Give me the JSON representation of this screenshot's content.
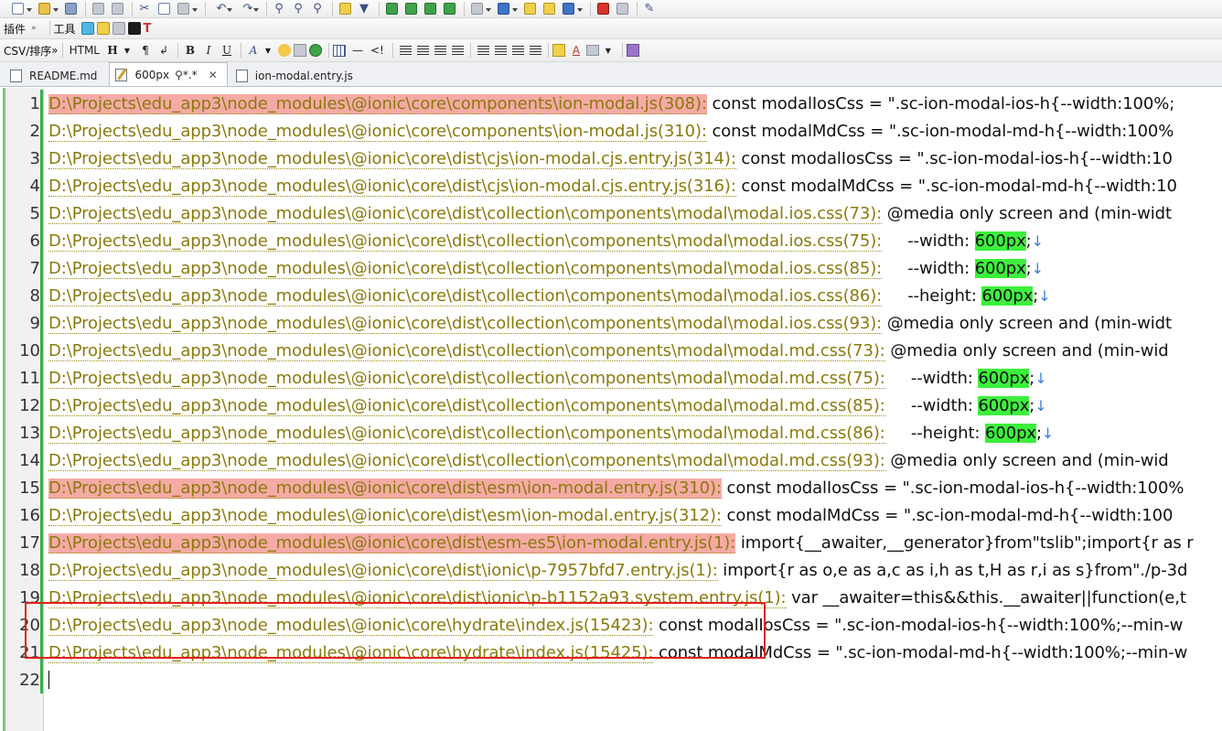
{
  "toolbar2": {
    "plugins": "插件",
    "tools": "工具"
  },
  "toolbar3": {
    "csv": "CSV/排序",
    "html": "HTML",
    "heading": "H",
    "pilcrow": "¶",
    "bold": "B",
    "italic": "I",
    "underline": "U",
    "font_color": "A"
  },
  "tabs": [
    {
      "label": "README.md",
      "active": false
    },
    {
      "label": "600px",
      "suffix": "*.*",
      "active": true
    },
    {
      "label": "ion-modal.entry.js",
      "active": false
    }
  ],
  "editor": {
    "lines": [
      {
        "n": "1",
        "path": "D:\\Projects\\edu_app3\\node_modules\\@ionic\\core\\components\\ion-modal.js(308):",
        "hl": true,
        "pre": " const modalIosCss = \".sc-ion-modal-ios-h{--width:100%;",
        "sel": "",
        "post": ""
      },
      {
        "n": "2",
        "path": "D:\\Projects\\edu_app3\\node_modules\\@ionic\\core\\components\\ion-modal.js(310):",
        "hl": false,
        "pre": " const modalMdCss = \".sc-ion-modal-md-h{--width:100%",
        "sel": "",
        "post": ""
      },
      {
        "n": "3",
        "path": "D:\\Projects\\edu_app3\\node_modules\\@ionic\\core\\dist\\cjs\\ion-modal.cjs.entry.js(314):",
        "hl": false,
        "pre": " const modalIosCss = \".sc-ion-modal-ios-h{--width:10",
        "sel": "",
        "post": ""
      },
      {
        "n": "4",
        "path": "D:\\Projects\\edu_app3\\node_modules\\@ionic\\core\\dist\\cjs\\ion-modal.cjs.entry.js(316):",
        "hl": false,
        "pre": " const modalMdCss = \".sc-ion-modal-md-h{--width:10",
        "sel": "",
        "post": ""
      },
      {
        "n": "5",
        "path": "D:\\Projects\\edu_app3\\node_modules\\@ionic\\core\\dist\\collection\\components\\modal\\modal.ios.css(73):",
        "hl": false,
        "pre": " @media only screen and (min-widt",
        "sel": "",
        "post": ""
      },
      {
        "n": "6",
        "path": "D:\\Projects\\edu_app3\\node_modules\\@ionic\\core\\dist\\collection\\components\\modal\\modal.ios.css(75):",
        "hl": false,
        "pre": "     --width: ",
        "sel": "600px",
        "post": ";"
      },
      {
        "n": "7",
        "path": "D:\\Projects\\edu_app3\\node_modules\\@ionic\\core\\dist\\collection\\components\\modal\\modal.ios.css(85):",
        "hl": false,
        "pre": "     --width: ",
        "sel": "600px",
        "post": ";"
      },
      {
        "n": "8",
        "path": "D:\\Projects\\edu_app3\\node_modules\\@ionic\\core\\dist\\collection\\components\\modal\\modal.ios.css(86):",
        "hl": false,
        "pre": "     --height: ",
        "sel": "600px",
        "post": ";"
      },
      {
        "n": "9",
        "path": "D:\\Projects\\edu_app3\\node_modules\\@ionic\\core\\dist\\collection\\components\\modal\\modal.ios.css(93):",
        "hl": false,
        "pre": " @media only screen and (min-widt",
        "sel": "",
        "post": ""
      },
      {
        "n": "10",
        "path": "D:\\Projects\\edu_app3\\node_modules\\@ionic\\core\\dist\\collection\\components\\modal\\modal.md.css(73):",
        "hl": false,
        "pre": " @media only screen and (min-wid",
        "sel": "",
        "post": ""
      },
      {
        "n": "11",
        "path": "D:\\Projects\\edu_app3\\node_modules\\@ionic\\core\\dist\\collection\\components\\modal\\modal.md.css(75):",
        "hl": false,
        "pre": "     --width: ",
        "sel": "600px",
        "post": ";"
      },
      {
        "n": "12",
        "path": "D:\\Projects\\edu_app3\\node_modules\\@ionic\\core\\dist\\collection\\components\\modal\\modal.md.css(85):",
        "hl": false,
        "pre": "     --width: ",
        "sel": "600px",
        "post": ";"
      },
      {
        "n": "13",
        "path": "D:\\Projects\\edu_app3\\node_modules\\@ionic\\core\\dist\\collection\\components\\modal\\modal.md.css(86):",
        "hl": false,
        "pre": "     --height: ",
        "sel": "600px",
        "post": ";"
      },
      {
        "n": "14",
        "path": "D:\\Projects\\edu_app3\\node_modules\\@ionic\\core\\dist\\collection\\components\\modal\\modal.md.css(93):",
        "hl": false,
        "pre": " @media only screen and (min-wid",
        "sel": "",
        "post": ""
      },
      {
        "n": "15",
        "path": "D:\\Projects\\edu_app3\\node_modules\\@ionic\\core\\dist\\esm\\ion-modal.entry.js(310):",
        "hl": true,
        "pre": " const modalIosCss = \".sc-ion-modal-ios-h{--width:100%",
        "sel": "",
        "post": ""
      },
      {
        "n": "16",
        "path": "D:\\Projects\\edu_app3\\node_modules\\@ionic\\core\\dist\\esm\\ion-modal.entry.js(312):",
        "hl": false,
        "pre": " const modalMdCss = \".sc-ion-modal-md-h{--width:100",
        "sel": "",
        "post": ""
      },
      {
        "n": "17",
        "path": "D:\\Projects\\edu_app3\\node_modules\\@ionic\\core\\dist\\esm-es5\\ion-modal.entry.js(1):",
        "hl": true,
        "pre": " import{__awaiter,__generator}from\"tslib\";import{r as r",
        "sel": "",
        "post": ""
      },
      {
        "n": "18",
        "path": "D:\\Projects\\edu_app3\\node_modules\\@ionic\\core\\dist\\ionic\\p-7957bfd7.entry.js(1):",
        "hl": false,
        "pre": " import{r as o,e as a,c as i,h as t,H as r,i as s}from\"./p-3d",
        "sel": "",
        "post": ""
      },
      {
        "n": "19",
        "path": "D:\\Projects\\edu_app3\\node_modules\\@ionic\\core\\dist\\ionic\\p-b1152a93.system.entry.js(1):",
        "hl": false,
        "pre": " var __awaiter=this&&this.__awaiter||function(e,t",
        "sel": "",
        "post": ""
      },
      {
        "n": "20",
        "path": "D:\\Projects\\edu_app3\\node_modules\\@ionic\\core\\hydrate\\index.js(15423):",
        "hl": false,
        "pre": " const modalIosCss = \".sc-ion-modal-ios-h{--width:100%;--min-w",
        "sel": "",
        "post": ""
      },
      {
        "n": "21",
        "path": "D:\\Projects\\edu_app3\\node_modules\\@ionic\\core\\hydrate\\index.js(15425):",
        "hl": false,
        "pre": " const modalMdCss = \".sc-ion-modal-md-h{--width:100%;--min-w",
        "sel": "",
        "post": ""
      },
      {
        "n": "22",
        "path": "",
        "hl": false,
        "pre": "",
        "sel": "",
        "post": ""
      }
    ],
    "eol_arrow": "↓"
  }
}
